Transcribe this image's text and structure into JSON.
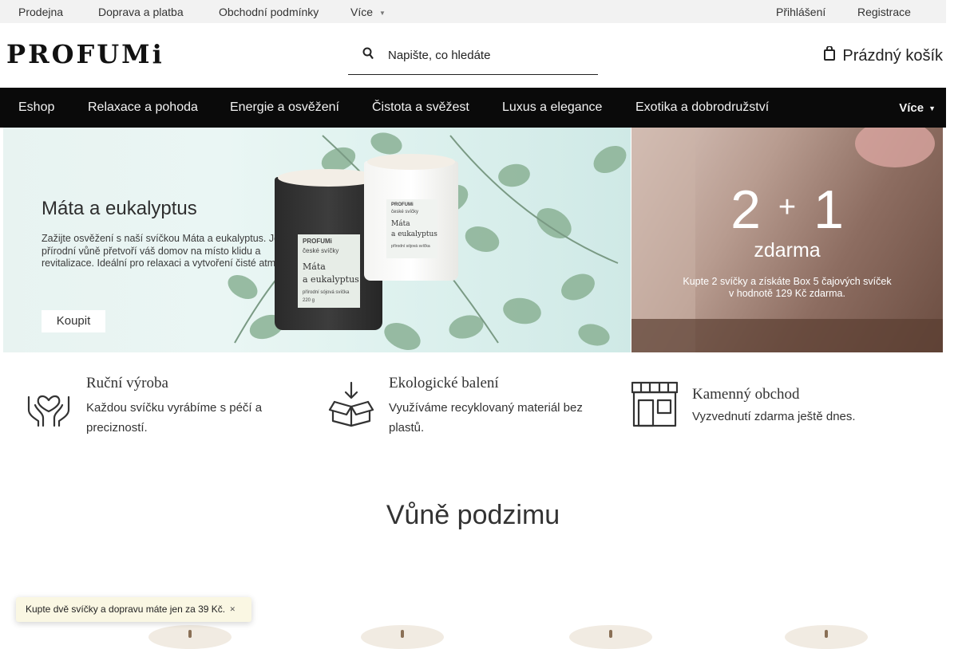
{
  "topbar": {
    "links": [
      "Prodejna",
      "Doprava a platba",
      "Obchodní podmínky"
    ],
    "more": "Více",
    "login": "Přihlášení",
    "register": "Registrace"
  },
  "header": {
    "logo": "PROFUMi",
    "search_placeholder": "Napište, co hledáte",
    "cart_label": "Prázdný košík"
  },
  "nav": {
    "items": [
      "Eshop",
      "Relaxace a pohoda",
      "Energie a osvěžení",
      "Čistota a svěžest",
      "Luxus a elegance",
      "Exotika a dobrodružství"
    ],
    "more": "Více"
  },
  "banner_left": {
    "title": "Máta a eukalyptus",
    "text": "Zažijte osvěžení s naší svíčkou Máta a eukalyptus. Její přírodní vůně přetvoří váš domov na místo klidu a revitalizace. Ideální pro relaxaci a vytvoření čisté atmosféry.",
    "button": "Koupit",
    "candle_brand": "PROFUMi",
    "candle_line": "české svíčky",
    "candle_name_1": "Máta",
    "candle_name_2": "a eukalyptus",
    "candle_type": "přírodní sójová svíčka",
    "candle_weight": "220 g"
  },
  "banner_right": {
    "num_a": "2",
    "plus": "+",
    "num_b": "1",
    "subtitle": "zdarma",
    "text_1": "Kupte 2 svíčky a získáte Box 5 čajových svíček",
    "text_2": "v hodnotě 129 Kč zdarma."
  },
  "features": [
    {
      "icon": "heart-hands-icon",
      "title": "Ruční výroba",
      "text": "Každou svíčku vyrábíme s péčí a precizností."
    },
    {
      "icon": "package-icon",
      "title": "Ekologické balení",
      "text": "Využíváme recyklovaný materiál bez plastů."
    },
    {
      "icon": "storefront-icon",
      "title": "Kamenný obchod",
      "text": "Vyzvednutí zdarma ještě dnes."
    }
  ],
  "section": {
    "title": "Vůně podzimu"
  },
  "toast": {
    "text": "Kupte dvě svíčky a dopravu máte jen za 39 Kč."
  },
  "colors": {
    "nav_bg": "#0a0a0a",
    "topbar_bg": "#f2f2f2",
    "toast_bg": "#faf7e3"
  }
}
